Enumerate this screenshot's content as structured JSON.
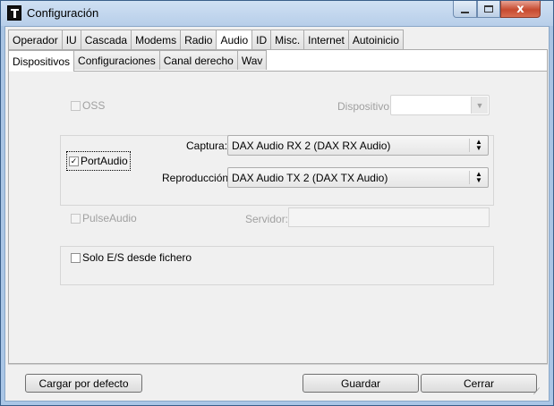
{
  "window": {
    "title": "Configuración",
    "minimize_label": "",
    "maximize_label": "",
    "close_label": "x"
  },
  "tabs_main": [
    "Operador",
    "IU",
    "Cascada",
    "Modems",
    "Radio",
    "Audio",
    "ID",
    "Misc.",
    "Internet",
    "Autoinicio"
  ],
  "tabs_main_active": "Audio",
  "tabs_sub": [
    "Dispositivos",
    "Configuraciones",
    "Canal derecho",
    "Wav"
  ],
  "tabs_sub_active": "Dispositivos",
  "oss": {
    "checkbox_label": "OSS",
    "checked": false,
    "enabled": false,
    "device_label": "Dispositivo:",
    "device_value": ""
  },
  "portaudio": {
    "checkbox_label": "PortAudio",
    "checked": true,
    "check_glyph": "✓",
    "capture_label": "Captura:",
    "capture_value": "DAX Audio RX 2 (DAX RX Audio)",
    "playback_label": "Reproducción:",
    "playback_value": "DAX Audio TX 2 (DAX TX Audio)"
  },
  "pulseaudio": {
    "checkbox_label": "PulseAudio",
    "checked": false,
    "enabled": false,
    "server_label": "Servidor:",
    "server_value": ""
  },
  "solo": {
    "checkbox_label": "Solo E/S desde fichero",
    "checked": false
  },
  "buttons": {
    "defaults": "Cargar por defecto",
    "save": "Guardar",
    "close": "Cerrar"
  },
  "colors": {
    "title_bar": "#b7cee9",
    "close_button": "#c74a2f",
    "dialog_bg": "#f0f0f0"
  }
}
